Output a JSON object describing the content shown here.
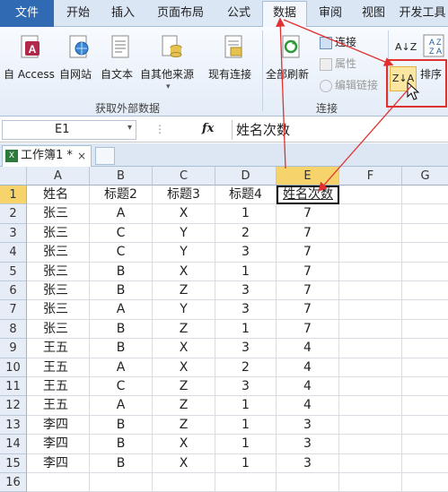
{
  "ribbon_tabs": [
    "文件",
    "开始",
    "插入",
    "页面布局",
    "公式",
    "数据",
    "审阅",
    "视图",
    "开发工具"
  ],
  "active_tab": "数据",
  "ext_data": {
    "buttons": [
      "自 Access",
      "自网站",
      "自文本",
      "自其他来源",
      "现有连接"
    ],
    "group_label": "获取外部数据"
  },
  "connections": {
    "refresh_all": "全部刷新",
    "items": [
      "连接",
      "属性",
      "编辑链接"
    ],
    "group_label": "连接"
  },
  "sort": {
    "sort_label": "排序",
    "az_label": "A↓Z",
    "za_label": "Z↓A"
  },
  "namebox_value": "E1",
  "fx_symbol": "fx",
  "formula_content": "姓名次数",
  "workbook_tab": "工作簿1 *",
  "column_headers": [
    "A",
    "B",
    "C",
    "D",
    "E",
    "F",
    "G"
  ],
  "row_numbers": [
    "1",
    "2",
    "3",
    "4",
    "5",
    "6",
    "7",
    "8",
    "9",
    "10",
    "11",
    "12",
    "13",
    "14",
    "15",
    "16"
  ],
  "rows": [
    [
      "姓名",
      "标题2",
      "标题3",
      "标题4",
      "姓名次数"
    ],
    [
      "张三",
      "A",
      "X",
      "1",
      "7"
    ],
    [
      "张三",
      "C",
      "Y",
      "2",
      "7"
    ],
    [
      "张三",
      "C",
      "Y",
      "3",
      "7"
    ],
    [
      "张三",
      "B",
      "X",
      "1",
      "7"
    ],
    [
      "张三",
      "B",
      "Z",
      "3",
      "7"
    ],
    [
      "张三",
      "A",
      "Y",
      "3",
      "7"
    ],
    [
      "张三",
      "B",
      "Z",
      "1",
      "7"
    ],
    [
      "王五",
      "B",
      "X",
      "3",
      "4"
    ],
    [
      "王五",
      "A",
      "X",
      "2",
      "4"
    ],
    [
      "王五",
      "C",
      "Z",
      "3",
      "4"
    ],
    [
      "王五",
      "A",
      "Z",
      "1",
      "4"
    ],
    [
      "李四",
      "B",
      "Z",
      "1",
      "3"
    ],
    [
      "李四",
      "B",
      "X",
      "1",
      "3"
    ],
    [
      "李四",
      "B",
      "X",
      "1",
      "3"
    ],
    [
      "",
      "",
      "",
      "",
      ""
    ]
  ],
  "colors": {
    "accent": "#2f6ab2",
    "selected_header": "#f6d36b",
    "annotation_red": "#e03030"
  }
}
